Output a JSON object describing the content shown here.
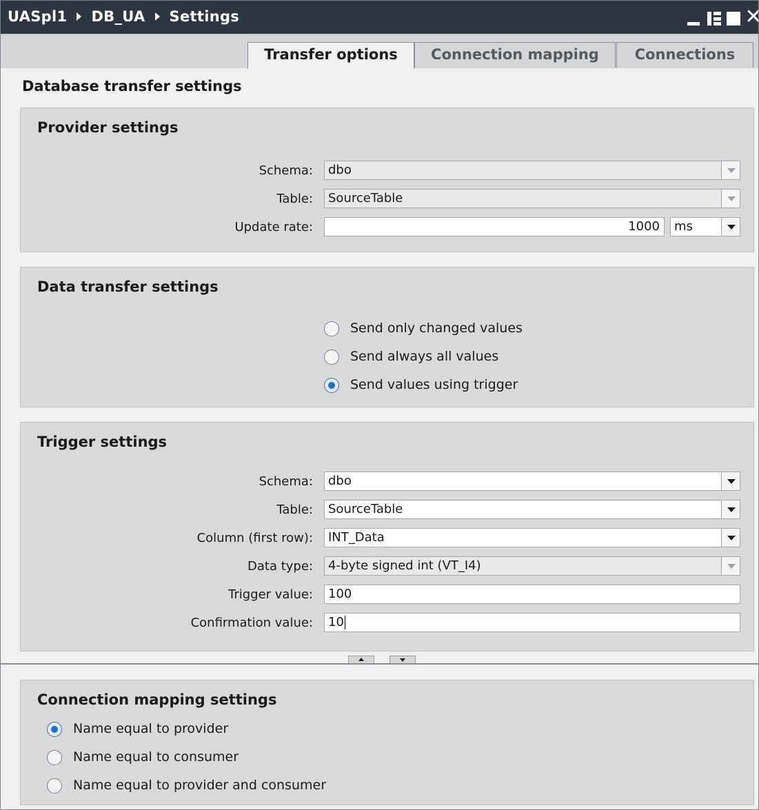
{
  "titlebar": {
    "breadcrumbs": [
      "UASpl1",
      "DB_UA",
      "Settings"
    ]
  },
  "tabs": [
    {
      "label": "Transfer options",
      "active": true
    },
    {
      "label": "Connection mapping",
      "active": false
    },
    {
      "label": "Connections",
      "active": false
    }
  ],
  "section_title": "Database transfer settings",
  "provider": {
    "title": "Provider settings",
    "schema_label": "Schema:",
    "schema_value": "dbo",
    "table_label": "Table:",
    "table_value": "SourceTable",
    "update_rate_label": "Update rate:",
    "update_rate_value": "1000",
    "update_rate_unit": "ms"
  },
  "data_transfer": {
    "title": "Data transfer settings",
    "options": [
      {
        "label": "Send only changed values",
        "selected": false
      },
      {
        "label": "Send always all values",
        "selected": false
      },
      {
        "label": "Send values using trigger",
        "selected": true
      }
    ]
  },
  "trigger": {
    "title": "Trigger settings",
    "schema_label": "Schema:",
    "schema_value": "dbo",
    "table_label": "Table:",
    "table_value": "SourceTable",
    "column_label": "Column (first row):",
    "column_value": "INT_Data",
    "datatype_label": "Data type:",
    "datatype_value": "4-byte signed int (VT_I4)",
    "trigger_value_label": "Trigger value:",
    "trigger_value": "100",
    "confirmation_label": "Confirmation value:",
    "confirmation_value": "10"
  },
  "connection_mapping": {
    "title": "Connection mapping settings",
    "options": [
      {
        "label": "Name equal to provider",
        "selected": true
      },
      {
        "label": "Name equal to consumer",
        "selected": false
      },
      {
        "label": "Name equal to provider and consumer",
        "selected": false
      }
    ]
  }
}
